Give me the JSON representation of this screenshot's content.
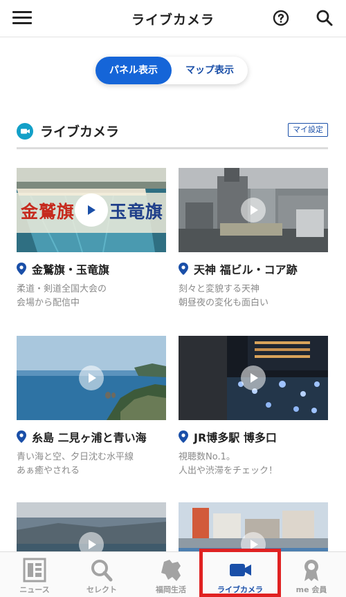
{
  "header": {
    "title": "ライブカメラ"
  },
  "view_switch": {
    "panel_label": "パネル表示",
    "map_label": "マップ表示"
  },
  "section": {
    "title": "ライブカメラ",
    "settings_label": "マイ設定"
  },
  "cameras": [
    {
      "title": "金鷲旗・玉竜旗",
      "desc1": "柔道・剣道全国大会の",
      "desc2": "会場から配信中",
      "overlay_left": "金鷲旗",
      "overlay_right": "玉竜旗"
    },
    {
      "title": "天神 福ビル・コア跡",
      "desc1": "刻々と変貌する天神",
      "desc2": "朝昼夜の変化も面白い"
    },
    {
      "title": "糸島 二見ヶ浦と青い海",
      "desc1": "青い海と空、夕日沈む水平線",
      "desc2": "あぁ癒やされる"
    },
    {
      "title": "JR博多駅 博多口",
      "desc1": "視聴数No.1。",
      "desc2": "人出や渋滞をチェック！"
    }
  ],
  "tabs": [
    {
      "label": "ニュース",
      "icon": "news-icon"
    },
    {
      "label": "セレクト",
      "icon": "search-icon"
    },
    {
      "label": "福岡生活",
      "icon": "fukuoka-map-icon"
    },
    {
      "label": "ライブカメラ",
      "icon": "video-camera-icon",
      "active": true
    },
    {
      "label": "me 会員",
      "icon": "badge-icon"
    }
  ],
  "colors": {
    "accent": "#1565d8",
    "link": "#1a4fa8",
    "section_icon": "#13a0c8",
    "highlight": "#e02222"
  }
}
